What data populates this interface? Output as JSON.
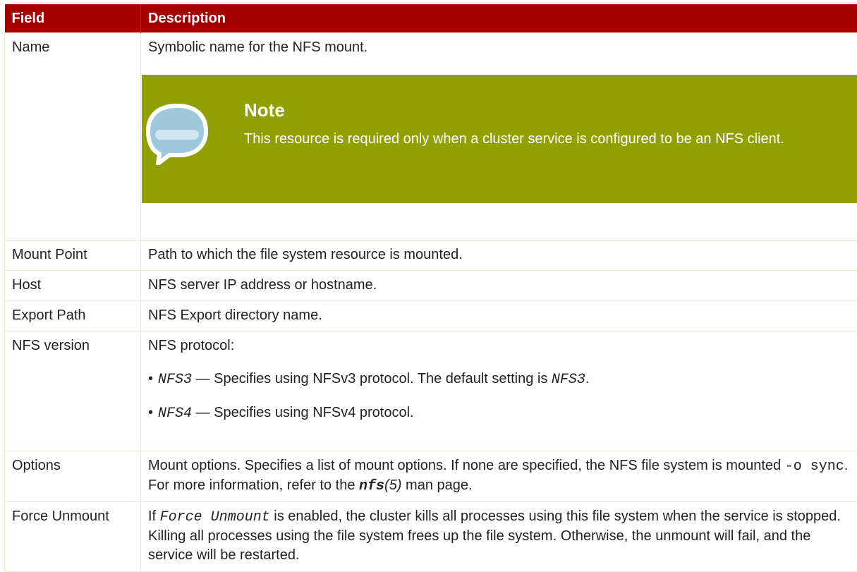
{
  "header": {
    "field": "Field",
    "description": "Description"
  },
  "rows": {
    "name": {
      "field": "Name",
      "description": "Symbolic name for the NFS mount."
    },
    "note": {
      "icon": "speech-bubble-icon",
      "title": "Note",
      "text": "This resource is required only when a cluster service is configured to be an NFS client."
    },
    "mount_point": {
      "field": "Mount Point",
      "description": "Path to which the file system resource is mounted."
    },
    "host": {
      "field": "Host",
      "description": "NFS server IP address or hostname."
    },
    "export_path": {
      "field": "Export Path",
      "description": "NFS Export directory name."
    },
    "nfs_version": {
      "field": "NFS version",
      "description": "NFS protocol:",
      "items": [
        {
          "code": "NFS3",
          "text": " — Specifies using NFSv3 protocol. The default setting is ",
          "code2": "NFS3",
          "end": "."
        },
        {
          "code": "NFS4",
          "text": " — Specifies using NFSv4 protocol."
        }
      ]
    },
    "options": {
      "field": "Options",
      "part1": "Mount options. Specifies a list of mount options. If none are specified, the NFS file system is mounted ",
      "code": "-o sync",
      "part2": ". For more information, refer to the ",
      "man": "nfs",
      "man_section": "(5)",
      "part3": " man page."
    },
    "force_unmount": {
      "field": "Force Unmount",
      "part1": "If ",
      "code": "Force Unmount",
      "part2": " is enabled, the cluster kills all processes using this file system when the service is stopped. Killing all processes using the file system frees up the file system. Otherwise, the unmount will fail, and the service will be restarted."
    }
  },
  "colors": {
    "header_bg": "#a70000",
    "note_bg": "#8fa000",
    "border": "#ece7d5"
  }
}
